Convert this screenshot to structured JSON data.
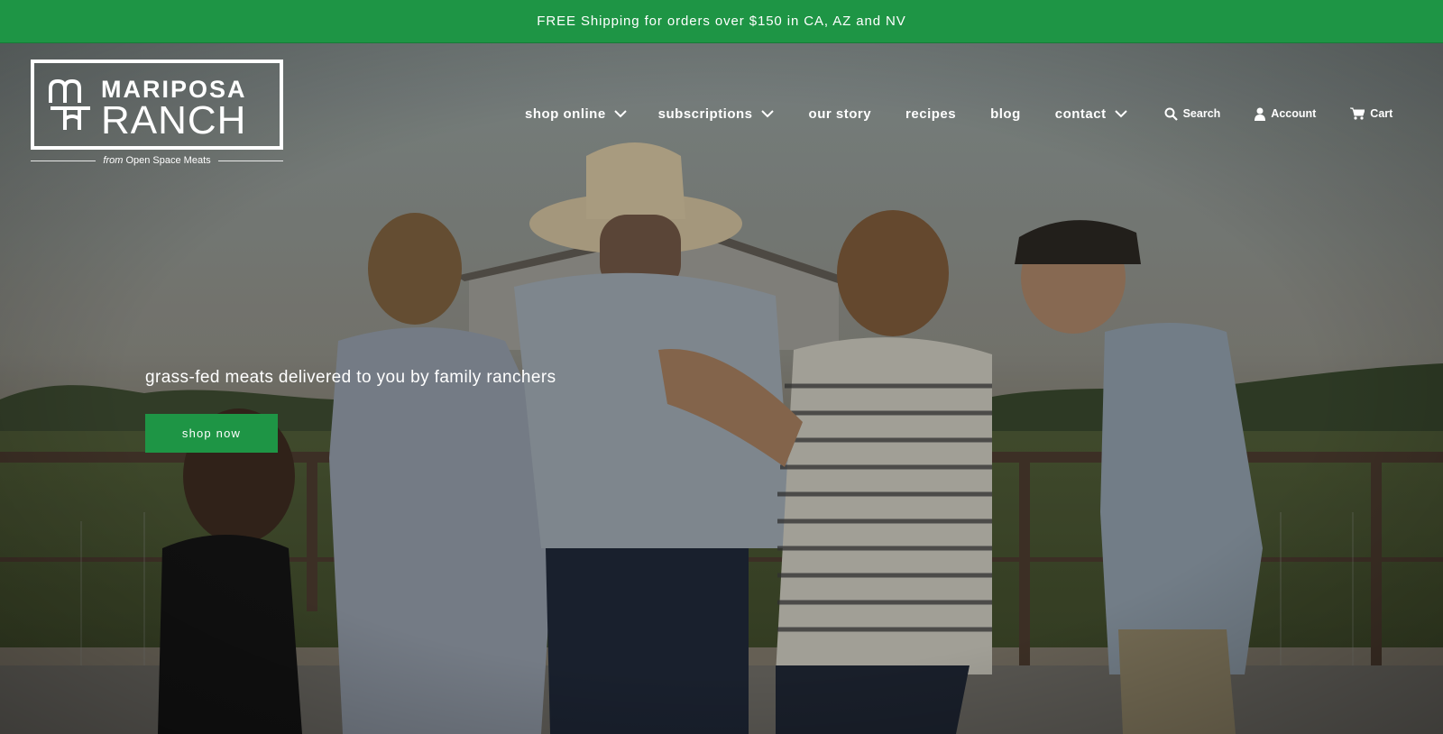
{
  "announcement": {
    "text": "FREE Shipping for orders over $150 in CA, AZ and NV"
  },
  "logo": {
    "line1": "MARIPOSA",
    "line2": "RANCH",
    "from": "from",
    "brand": "Open Space Meats"
  },
  "nav": {
    "items": [
      {
        "label": "shop online",
        "dropdown": true
      },
      {
        "label": "subscriptions",
        "dropdown": true
      },
      {
        "label": "our story",
        "dropdown": false
      },
      {
        "label": "recipes",
        "dropdown": false
      },
      {
        "label": "blog",
        "dropdown": false
      },
      {
        "label": "contact",
        "dropdown": true
      }
    ],
    "search_label": "Search",
    "account_label": "Account",
    "cart_label": "Cart"
  },
  "hero": {
    "tagline": "grass-fed meats delivered to you by family ranchers",
    "cta_label": "shop now"
  },
  "colors": {
    "brand_green": "#1e9545",
    "text_on_dark": "#ffffff"
  },
  "icons": [
    "chevron-down-icon",
    "search-icon",
    "account-icon",
    "cart-icon"
  ]
}
